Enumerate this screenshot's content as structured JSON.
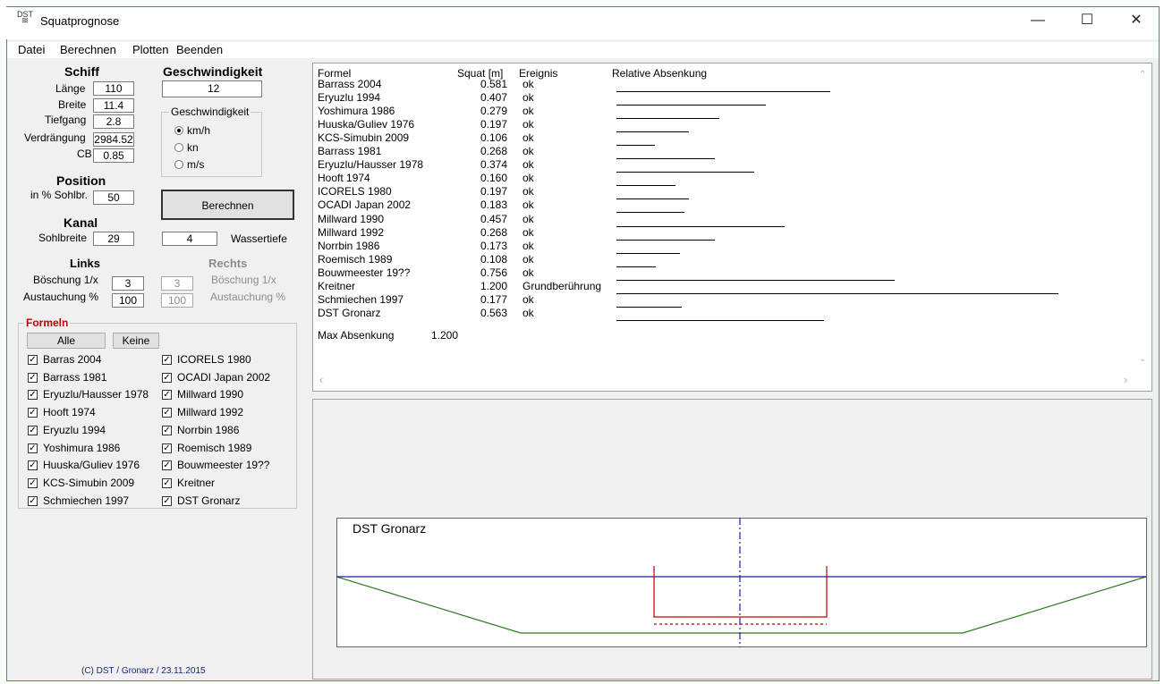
{
  "window": {
    "title": "Squatprognose",
    "icon_text": "DST",
    "controls": [
      "minimize-icon",
      "maximize-icon",
      "close-icon"
    ]
  },
  "menu": [
    "Datei",
    "Berechnen",
    "Plotten",
    "Beenden"
  ],
  "schiff": {
    "header": "Schiff",
    "laenge_label": "Länge",
    "laenge": "110",
    "breite_label": "Breite",
    "breite": "11.4",
    "tiefgang_label": "Tiefgang",
    "tiefgang": "2.8",
    "verdraengung_label": "Verdrängung",
    "verdraengung": "2984.52",
    "cb_label": "CB",
    "cb": "0.85"
  },
  "geschwindigkeit": {
    "header": "Geschwindigkeit",
    "value": "12",
    "group_title": "Geschwindigkeit",
    "units": [
      "km/h",
      "kn",
      "m/s"
    ],
    "selected_unit": "km/h"
  },
  "position": {
    "header": "Position",
    "label": "in % Sohlbr.",
    "value": "50"
  },
  "berechnen_button": "Berechnen",
  "kanal": {
    "header": "Kanal",
    "sohlbreite_label": "Sohlbreite",
    "sohlbreite": "29",
    "wassertiefe": "4",
    "wassertiefe_label": "Wassertiefe"
  },
  "links": {
    "header": "Links",
    "boeschung_label": "Böschung 1/x",
    "boeschung": "3",
    "austauchung_label": "Austauchung %",
    "austauchung": "100"
  },
  "rechts": {
    "header": "Rechts",
    "boeschung_label": "Böschung 1/x",
    "boeschung": "3",
    "austauchung_label": "Austauchung %",
    "austauchung": "100"
  },
  "formeln": {
    "title": "Formeln",
    "alle": "Alle",
    "keine": "Keine",
    "left": [
      "Barras 2004",
      "Barrass 1981",
      "Eryuzlu/Hausser 1978",
      "Hooft 1974",
      "Eryuzlu 1994",
      "Yoshimura 1986",
      "Huuska/Guliev 1976",
      "KCS-Simubin 2009",
      "Schmiechen 1997"
    ],
    "right": [
      "ICORELS 1980",
      "OCADI Japan 2002",
      "Millward 1990",
      "Millward 1992",
      "Norrbin 1986",
      "Roemisch 1989",
      "Bouwmeester 19??",
      "Kreitner",
      "DST Gronarz"
    ],
    "checked": true
  },
  "results": {
    "headers": [
      "Formel",
      "Squat [m]",
      "Ereignis",
      "Relative Absenkung"
    ],
    "rows": [
      {
        "formel": "Barrass 2004",
        "squat": "0.581",
        "ereignis": "ok",
        "rel": 0.484
      },
      {
        "formel": "Eryuzlu 1994",
        "squat": "0.407",
        "ereignis": "ok",
        "rel": 0.339
      },
      {
        "formel": "Yoshimura 1986",
        "squat": "0.279",
        "ereignis": "ok",
        "rel": 0.233
      },
      {
        "formel": "Huuska/Guliev 1976",
        "squat": "0.197",
        "ereignis": "ok",
        "rel": 0.164
      },
      {
        "formel": "KCS-Simubin 2009",
        "squat": "0.106",
        "ereignis": "ok",
        "rel": 0.088
      },
      {
        "formel": "Barrass 1981",
        "squat": "0.268",
        "ereignis": "ok",
        "rel": 0.223
      },
      {
        "formel": "Eryuzlu/Hausser 1978",
        "squat": "0.374",
        "ereignis": "ok",
        "rel": 0.312
      },
      {
        "formel": "Hooft 1974",
        "squat": "0.160",
        "ereignis": "ok",
        "rel": 0.133
      },
      {
        "formel": "ICORELS 1980",
        "squat": "0.197",
        "ereignis": "ok",
        "rel": 0.164
      },
      {
        "formel": "OCADI Japan 2002",
        "squat": "0.183",
        "ereignis": "ok",
        "rel": 0.153
      },
      {
        "formel": "Millward 1990",
        "squat": "0.457",
        "ereignis": "ok",
        "rel": 0.381
      },
      {
        "formel": "Millward 1992",
        "squat": "0.268",
        "ereignis": "ok",
        "rel": 0.223
      },
      {
        "formel": "Norrbin 1986",
        "squat": "0.173",
        "ereignis": "ok",
        "rel": 0.144
      },
      {
        "formel": "Roemisch 1989",
        "squat": "0.108",
        "ereignis": "ok",
        "rel": 0.09
      },
      {
        "formel": "Bouwmeester 19??",
        "squat": "0.756",
        "ereignis": "ok",
        "rel": 0.63
      },
      {
        "formel": "Kreitner",
        "squat": "1.200",
        "ereignis": "Grundberührung",
        "rel": 1.0
      },
      {
        "formel": "Schmiechen 1997",
        "squat": "0.177",
        "ereignis": "ok",
        "rel": 0.148
      },
      {
        "formel": "DST Gronarz",
        "squat": "0.563",
        "ereignis": "ok",
        "rel": 0.469
      }
    ],
    "max_label": "Max Absenkung",
    "max_value": "1.200"
  },
  "plot": {
    "label": "DST Gronarz"
  },
  "copyright": "(C) DST / Gronarz / 23.11.2015"
}
